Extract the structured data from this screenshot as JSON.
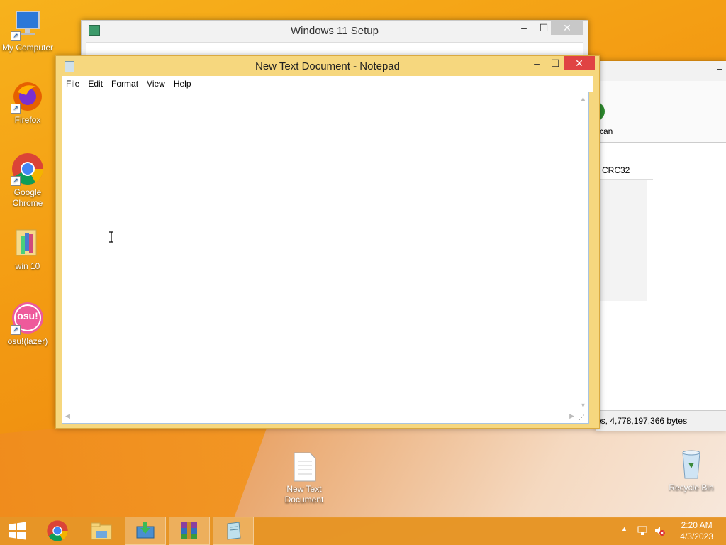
{
  "desktop": {
    "icons": [
      {
        "label": "My Computer"
      },
      {
        "label": "Firefox"
      },
      {
        "label": "Google Chrome"
      },
      {
        "label": "win 10"
      },
      {
        "label": "osu!(lazer)"
      },
      {
        "label": "New Text Document"
      },
      {
        "label": "Recycle Bin"
      }
    ],
    "osu_badge": "osu!"
  },
  "setup_window": {
    "title": "Windows 11 Setup",
    "min": "–",
    "max": "☐",
    "close": "✕"
  },
  "back_window": {
    "button_label": "can",
    "column_header": "CRC32",
    "status": "es, 4,778,197,366 bytes",
    "min": "–"
  },
  "notepad": {
    "title": "New Text Document - Notepad",
    "min": "–",
    "max": "☐",
    "close": "✕",
    "menu": [
      "File",
      "Edit",
      "Format",
      "View",
      "Help"
    ],
    "content": ""
  },
  "taskbar": {
    "items": [
      "start-icon",
      "chrome-icon",
      "file-explorer-icon",
      "setup-icon",
      "winrar-icon",
      "notepad-icon"
    ],
    "tray_arrow": "▲",
    "time": "2:20 AM",
    "date": "4/3/2023"
  },
  "colors": {
    "accent": "#f39a12",
    "notepad_frame": "#f6d77e",
    "close_button": "#e04343"
  }
}
